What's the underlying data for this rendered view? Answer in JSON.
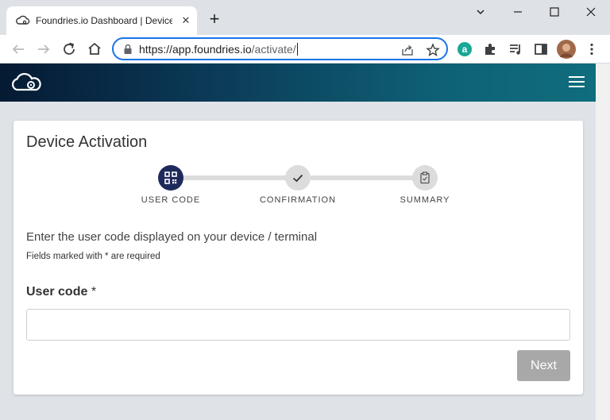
{
  "browser": {
    "tab_title": "Foundries.io Dashboard | Device",
    "url_host": "https://app.foundries.io",
    "url_path": "/activate/"
  },
  "page": {
    "title": "Device Activation",
    "steps": [
      {
        "label": "USER CODE",
        "state": "active"
      },
      {
        "label": "CONFIRMATION",
        "state": "pending"
      },
      {
        "label": "SUMMARY",
        "state": "pending"
      }
    ],
    "instructions": "Enter the user code displayed on your device / terminal",
    "required_note": "Fields marked with * are required",
    "user_code_label": "User code",
    "required_marker": "*",
    "user_code_value": "",
    "next_label": "Next"
  },
  "colors": {
    "accent": "#1a73e8",
    "step_active": "#1f2a5c",
    "step_pending": "#dcdcdc",
    "button_disabled": "#a8a8a8"
  }
}
